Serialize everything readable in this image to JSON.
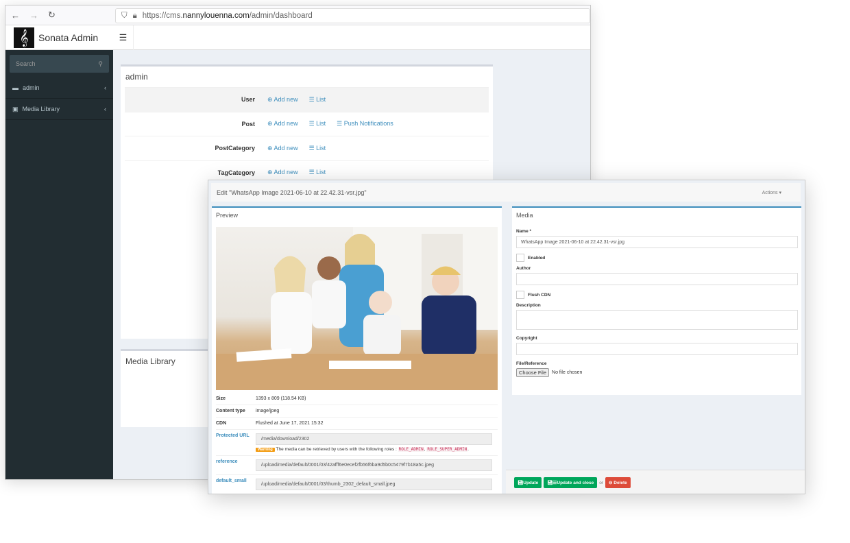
{
  "browser": {
    "url_prefix": "https://cms.",
    "url_host": "nannylouenna.com",
    "url_path": "/admin/dashboard"
  },
  "app": {
    "title": "Sonata Admin",
    "logo_glyph": "𝄞"
  },
  "sidebar": {
    "search_placeholder": "Search",
    "items": [
      {
        "label": "admin",
        "icon": "folder-icon"
      },
      {
        "label": "Media Library",
        "icon": "image-icon"
      }
    ]
  },
  "dashboard": {
    "title": "admin",
    "rows": [
      {
        "label": "User",
        "links": [
          "Add new",
          "List"
        ]
      },
      {
        "label": "Post",
        "links": [
          "Add new",
          "List",
          "Push Notifications"
        ]
      },
      {
        "label": "PostCategory",
        "links": [
          "Add new",
          "List"
        ]
      },
      {
        "label": "TagCategory",
        "links": [
          "Add new",
          "List"
        ]
      }
    ],
    "media_title": "Media Library"
  },
  "edit": {
    "title": "Edit \"WhatsApp Image 2021-06-10 at 22.42.31-vsr.jpg\"",
    "actions": "Actions",
    "preview_title": "Preview",
    "info": {
      "size_label": "Size",
      "size": "1393 x 809 (118.54 KB)",
      "type_label": "Content type",
      "type": "image/jpeg",
      "cdn_label": "CDN",
      "cdn": "Flushed at June 17, 2021 15:32",
      "protected_label": "Protected URL",
      "protected": "/media/download/2302",
      "warning_badge": "Warning",
      "warning_text": "The media can be retrieved by users with the following roles :",
      "role1": "ROLE_ADMIN",
      "role2": "ROLE_SUPER_ADMIN",
      "reference_label": "reference",
      "reference": "/upload/media/default/0001/03/42afff6e0ecef2fb56f6ba9d5b0c5479f7b18a5c.jpeg",
      "small_label": "default_small",
      "small": "/upload/media/default/0001/03/thumb_2302_default_small.jpeg"
    },
    "form": {
      "title": "Media",
      "name_label": "Name *",
      "name_value": "WhatsApp Image 2021-06-10 at 22.42.31-vsr.jpg",
      "enabled": "Enabled",
      "author": "Author",
      "flush": "Flush CDN",
      "description": "Description",
      "copyright": "Copyright",
      "file": "File/Reference",
      "choose": "Choose File",
      "no_file": "No file chosen"
    },
    "buttons": {
      "update": "Update",
      "update_close": "Update and close",
      "or": "or",
      "delete": "Delete"
    }
  }
}
